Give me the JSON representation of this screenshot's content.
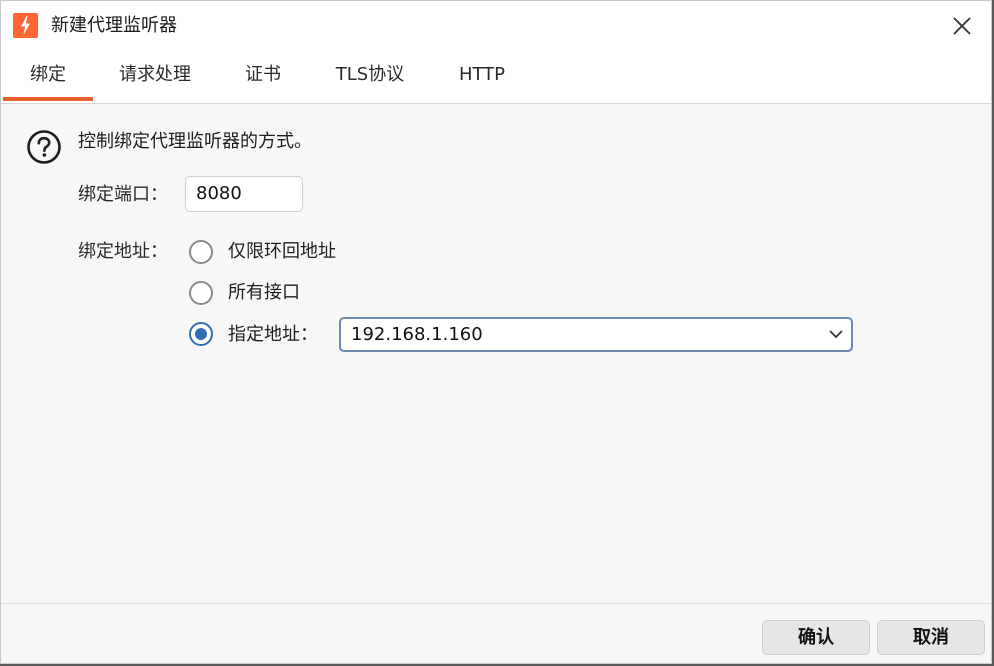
{
  "window": {
    "title": "新建代理监听器",
    "app_icon": "burp-lightning-icon",
    "close_icon": "close-icon"
  },
  "tabs": [
    {
      "label": "绑定",
      "active": true
    },
    {
      "label": "请求处理",
      "active": false
    },
    {
      "label": "证书",
      "active": false
    },
    {
      "label": "TLS协议",
      "active": false
    },
    {
      "label": "HTTP",
      "active": false
    }
  ],
  "binding": {
    "description": "控制绑定代理监听器的方式。",
    "port_label": "绑定端口：",
    "port_value": "8080",
    "address_label": "绑定地址：",
    "options": [
      {
        "label": "仅限环回地址",
        "checked": false
      },
      {
        "label": "所有接口",
        "checked": false
      },
      {
        "label": "指定地址：",
        "checked": true
      }
    ],
    "specific_address": "192.168.1.160"
  },
  "footer": {
    "ok_label": "确认",
    "cancel_label": "取消"
  },
  "colors": {
    "accent": "#e8612c",
    "radio_selected": "#2f6db5",
    "app_icon_bg": "#ff6633"
  }
}
